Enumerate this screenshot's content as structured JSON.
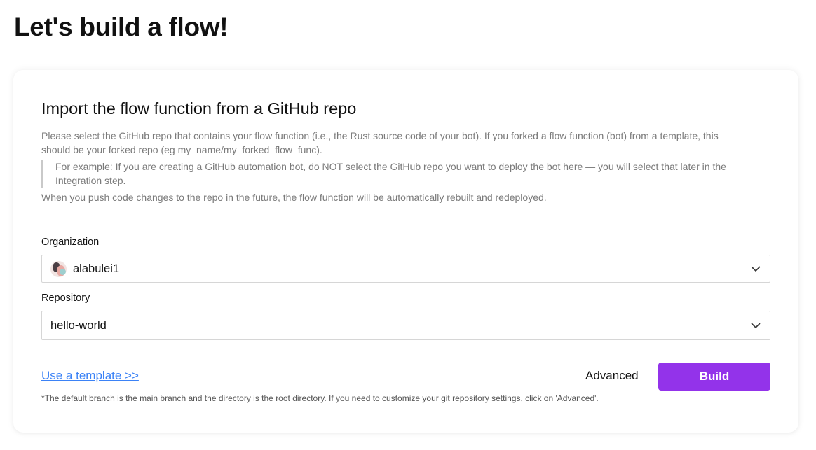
{
  "page": {
    "title": "Let's build a flow!"
  },
  "card": {
    "title": "Import the flow function from a GitHub repo",
    "description": "Please select the GitHub repo that contains your flow function (i.e., the Rust source code of your bot). If you forked a flow function (bot) from a template, this should be your forked repo (eg my_name/my_forked_flow_func).",
    "example": "For example: If you are creating a GitHub automation bot, do NOT select the GitHub repo you want to deploy the bot here — you will select that later in the Integration step.",
    "note": "When you push code changes to the repo in the future, the flow function will be automatically rebuilt and redeployed."
  },
  "form": {
    "organization": {
      "label": "Organization",
      "value": "alabulei1",
      "avatar_icon": "user-avatar"
    },
    "repository": {
      "label": "Repository",
      "value": "hello-world"
    }
  },
  "actions": {
    "template_link": "Use a template >>",
    "advanced_label": "Advanced",
    "build_label": "Build",
    "footnote": "*The default branch is the main branch and the directory is the root directory. If you need to customize your git repository settings, click on 'Advanced'."
  },
  "colors": {
    "accent": "#9333ea",
    "link": "#3b82f6",
    "muted_text": "#7a7a7a"
  }
}
